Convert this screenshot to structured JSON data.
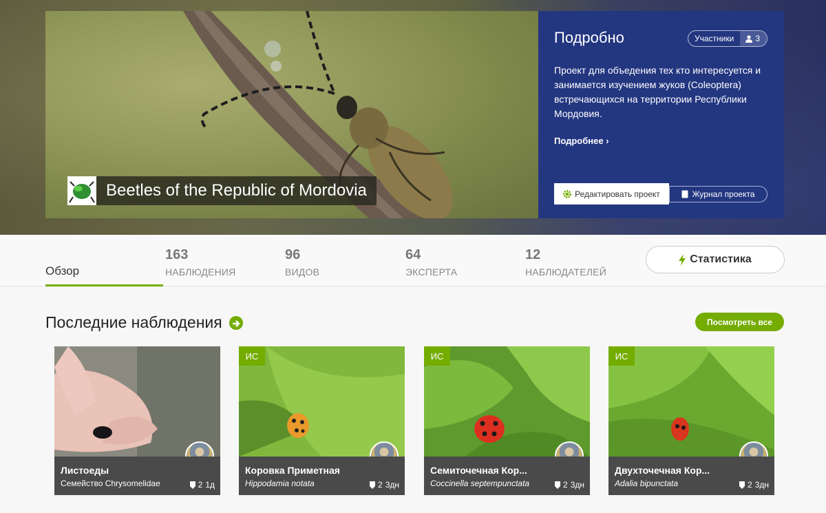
{
  "banner": {
    "project_name": "Beetles of the Republic of Mordovia"
  },
  "details": {
    "title": "Подробно",
    "members_label": "Участники",
    "members_count": "3",
    "description": "Проект для объедения тех кто интересуется и занимается изучением жуков (Coleoptera) встречающихся на территории Республики Мордовия.",
    "more_link": "Подробнее",
    "edit_button": "Редактировать проект",
    "journal_button": "Журнал проекта"
  },
  "tabs": {
    "overview": "Обзор",
    "stats": [
      {
        "number": "163",
        "label": "НАБЛЮДЕНИЯ"
      },
      {
        "number": "96",
        "label": "ВИДОВ"
      },
      {
        "number": "64",
        "label": "ЭКСПЕРТА"
      },
      {
        "number": "12",
        "label": "НАБЛЮДАТЕЛЕЙ"
      }
    ],
    "stats_button": "Статистика"
  },
  "section": {
    "title": "Последние наблюдения",
    "view_all": "Посмотреть все"
  },
  "observations": [
    {
      "badge": "",
      "name": "Листоеды",
      "taxon": "Семейство Chrysomelidae",
      "ids": "2",
      "age": "1д"
    },
    {
      "badge": "ИС",
      "name": "Коровка Приметная",
      "taxon": "Hippodamia notata",
      "ids": "2",
      "age": "3дн"
    },
    {
      "badge": "ИС",
      "name": "Семиточечная Кор...",
      "taxon": "Coccinella septempunctata",
      "ids": "2",
      "age": "3дн"
    },
    {
      "badge": "ИС",
      "name": "Двухточечная Кор...",
      "taxon": "Adalia bipunctata",
      "ids": "2",
      "age": "3дн"
    }
  ],
  "colors": {
    "accent_green": "#74ac00",
    "details_blue": "#233680",
    "card_info_bg": "#4a4a4a"
  }
}
